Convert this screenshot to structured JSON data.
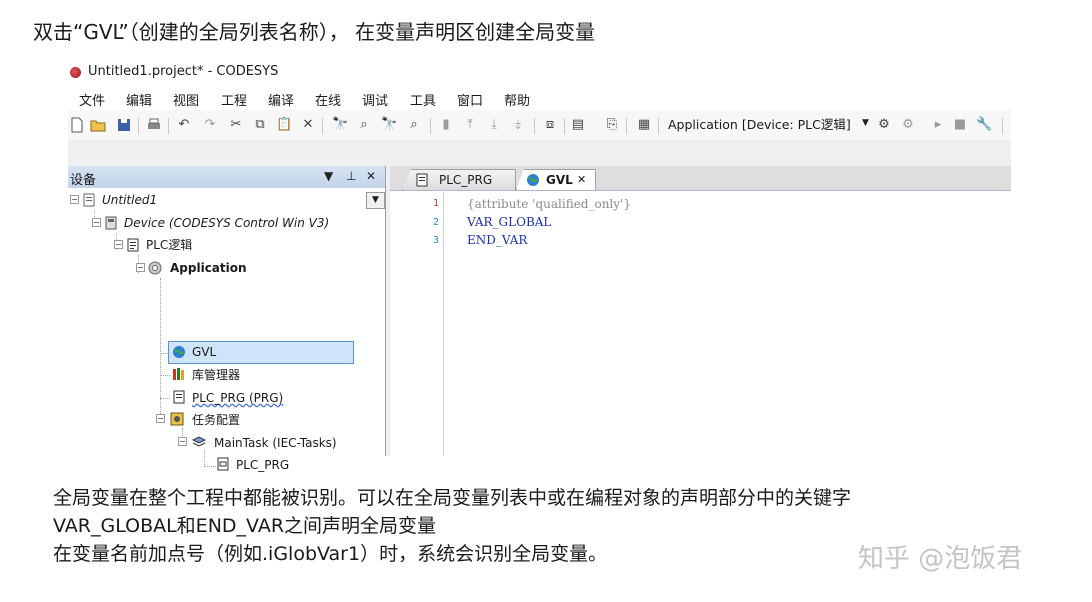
{
  "caption_top": "双击“GVL”（创建的全局列表名称）， 在变量声明区创建全局变量",
  "window": {
    "title": "Untitled1.project* - CODESYS",
    "menu": [
      "文件",
      "编辑",
      "视图",
      "工程",
      "编译",
      "在线",
      "调试",
      "工具",
      "窗口",
      "帮助"
    ],
    "toolbar": {
      "application_combo": "Application [Device: PLC逻辑]"
    }
  },
  "devices_pane": {
    "title": "设备",
    "header_icons": [
      "chevron-down-icon",
      "pin-icon",
      "close-icon"
    ],
    "tree": {
      "root": "Untitled1",
      "device": "Device (CODESYS Control Win V3)",
      "plc_logic": "PLC逻辑",
      "application": "Application",
      "gvl": "GVL",
      "library_manager": "库管理器",
      "plc_prg": "PLC_PRG (PRG)",
      "task_config": "任务配置",
      "main_task": "MainTask (IEC-Tasks)",
      "task_plc_prg": "PLC_PRG"
    }
  },
  "editor": {
    "tabs": [
      {
        "label": "PLC_PRG",
        "active": false
      },
      {
        "label": "GVL",
        "active": true
      }
    ],
    "line_numbers": [
      "1",
      "2",
      "3"
    ],
    "lines": [
      {
        "text": "{attribute 'qualified_only'}",
        "color": "#8a8a8a"
      },
      {
        "text": "VAR_GLOBAL",
        "color": "#1a2fb0"
      },
      {
        "text": "END_VAR",
        "color": "#1a2fb0"
      }
    ]
  },
  "caption_body": [
    "全局变量在整个工程中都能被识别。可以在全局变量列表中或在编程对象的声明部分中的关键字",
    "VAR_GLOBAL和END_VAR之间声明全局变量",
    "在变量名前加点号（例如.iGlobVar1）时，系统会识别全局变量。"
  ],
  "watermark": "知乎 @泡饭君",
  "colors": {
    "pane_header": "#c9d8ee",
    "selection": "#cde4f9",
    "selection_border": "#5b8fd0",
    "line_number": "#2b91af",
    "keyword": "#1a2fb0"
  }
}
